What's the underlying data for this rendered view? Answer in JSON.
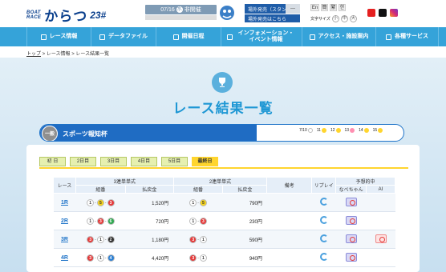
{
  "header": {
    "logo_top": "BOAT",
    "logo_bottom": "RACE",
    "logo_name": "からつ",
    "logo_number": "23#",
    "date": "07/16",
    "date_icon": "水",
    "date_status": "非開催",
    "info_venue_sales": "場外発売（スタンド棟）",
    "info_venue_sales_toggle": "",
    "info_outside": "場外発売はこちら",
    "lang": [
      "En",
      "簡",
      "繁",
      "한"
    ],
    "font_size_label": "文字サイズ",
    "font_size_options": [
      "小",
      "中",
      "大"
    ]
  },
  "nav": [
    {
      "label": "レース情報",
      "icon": "list-icon"
    },
    {
      "label": "データファイル",
      "icon": "folder-icon"
    },
    {
      "label": "開催日程",
      "icon": "calendar-icon"
    },
    {
      "label": "インフォメーション・イベント情報",
      "icon": "info-icon"
    },
    {
      "label": "アクセス・施設案内",
      "icon": "pin-icon"
    },
    {
      "label": "各種サービス",
      "icon": "star-icon"
    }
  ],
  "breadcrumb": [
    "トップ",
    "レース情報",
    "レース結果一覧"
  ],
  "page_title": "レース結果一覧",
  "race": {
    "grade": "一般",
    "name": "スポーツ報知杯",
    "days": [
      {
        "label": "7/10",
        "color": "#ffffff"
      },
      {
        "label": "11",
        "color": "#ffd52e"
      },
      {
        "label": "12",
        "color": "#ffd52e"
      },
      {
        "label": "13",
        "color": "#ff8fb1"
      },
      {
        "label": "14",
        "color": "#ffd52e"
      },
      {
        "label": "15",
        "color": "#ffd52e"
      }
    ]
  },
  "tabs": [
    "初 日",
    "2日目",
    "3日目",
    "4日目",
    "5日目",
    "最終日"
  ],
  "table": {
    "headers": {
      "race": "レース",
      "trifecta": "3連単単式",
      "combo": "組番",
      "payout": "払戻金",
      "exacta": "2連単単式",
      "note": "備考",
      "replay": "リプレイ",
      "predict": "予想的中",
      "nabe": "なべちゃん",
      "ai": "AI"
    },
    "yen": "円",
    "rows": [
      {
        "race": "1R",
        "tri": [
          "1",
          "5",
          "3"
        ],
        "tri_pay": "1,520",
        "ex": [
          "1",
          "5"
        ],
        "ex_pay": "790"
      },
      {
        "race": "2R",
        "tri": [
          "1",
          "3",
          "6"
        ],
        "tri_pay": "720",
        "ex": [
          "1",
          "3"
        ],
        "ex_pay": "230"
      },
      {
        "race": "3R",
        "tri": [
          "3",
          "1",
          "2"
        ],
        "tri_pay": "1,180",
        "ex": [
          "3",
          "1"
        ],
        "ex_pay": "590"
      },
      {
        "race": "4R",
        "tri": [
          "3",
          "1",
          "4"
        ],
        "tri_pay": "4,420",
        "ex": [
          "3",
          "1"
        ],
        "ex_pay": "940"
      }
    ]
  }
}
